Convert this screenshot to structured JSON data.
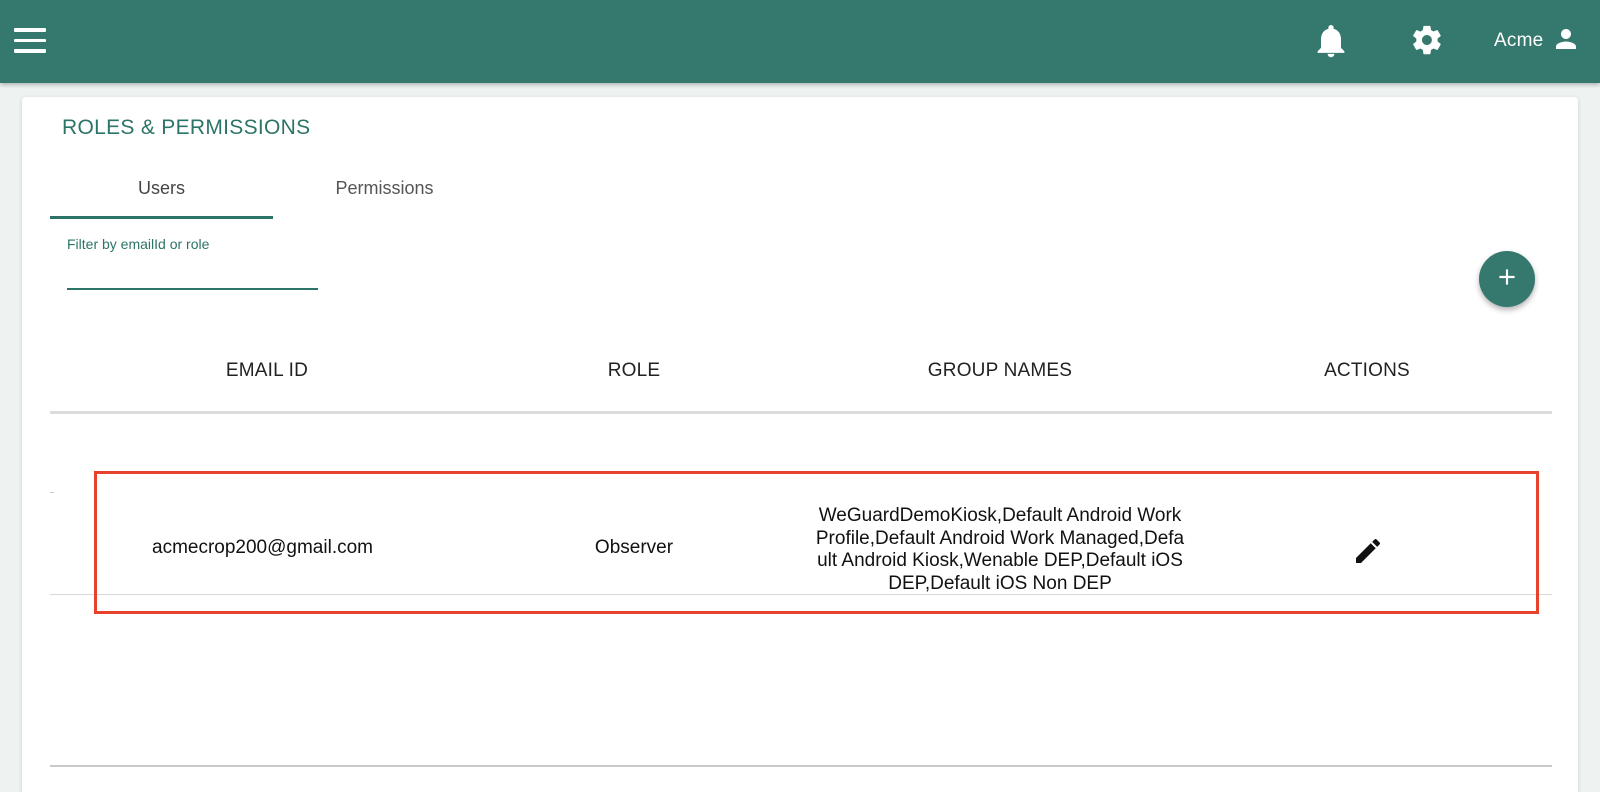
{
  "app": {
    "user_name": "Acme",
    "colors": {
      "brand": "#34786e",
      "accent": "#2d7468",
      "highlight": "#e8412c"
    }
  },
  "icons": {
    "menu": "menu-icon",
    "notifications": "bell-icon",
    "settings": "gear-icon",
    "account": "user-icon",
    "add": "plus-icon",
    "edit": "pencil-icon"
  },
  "page": {
    "title": "ROLES & PERMISSIONS"
  },
  "tabs": [
    {
      "label": "Users",
      "active": true
    },
    {
      "label": "Permissions",
      "active": false
    }
  ],
  "filter": {
    "label": "Filter by emailId or role",
    "value": ""
  },
  "table": {
    "columns": [
      "EMAIL ID",
      "ROLE",
      "GROUP NAMES",
      "ACTIONS"
    ],
    "rows": [
      {
        "email": "acmecrop200@gmail.com",
        "role": "Observer",
        "groups": "WeGuardDemoKiosk,Default Android Work Profile,Default Android Work Managed,Default Android Kiosk,Wenable DEP,Default iOS DEP,Default iOS Non DEP"
      }
    ]
  }
}
